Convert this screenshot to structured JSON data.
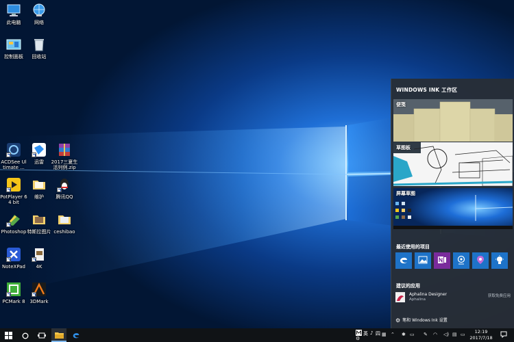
{
  "desktop": {
    "icons": [
      {
        "label": "此电脑",
        "icon": "computer-icon"
      },
      {
        "label": "网络",
        "icon": "network-icon"
      },
      {
        "label": "控制面板",
        "icon": "control-panel-icon"
      },
      {
        "label": "回收站",
        "icon": "recycle-bin-icon"
      },
      {
        "label": "ACDSee Ultimate ...",
        "icon": "acdsee-icon"
      },
      {
        "label": "迅雷",
        "icon": "xunlei-icon"
      },
      {
        "label": "2017三夏生活列例.zip",
        "icon": "winrar-archive-icon"
      },
      {
        "label": "PotPlayer 64 bit",
        "icon": "potplayer-icon"
      },
      {
        "label": "维护",
        "icon": "folder-icon"
      },
      {
        "label": "腾讯QQ",
        "icon": "qq-icon"
      },
      {
        "label": "Photoshop",
        "icon": "photoshop-icon"
      },
      {
        "label": "特斯拉图片",
        "icon": "image-folder-icon"
      },
      {
        "label": "ceshibao",
        "icon": "folder-icon"
      },
      {
        "label": "NoteXPad",
        "icon": "notexpad-icon"
      },
      {
        "label": "4K",
        "icon": "document-icon"
      },
      {
        "label": "PCMark 8",
        "icon": "pcmark-icon"
      },
      {
        "label": "3DMark",
        "icon": "3dmark-icon"
      }
    ]
  },
  "ink": {
    "title": "WINDOWS INK 工作区",
    "sticky_label": "便笺",
    "sketchpad_label": "草图板",
    "screen_sketch_label": "屏幕草图",
    "recent_title": "最近使用的项目",
    "recent_apps": [
      {
        "icon": "edge-icon",
        "color": "#1e73c8"
      },
      {
        "icon": "photos-icon",
        "color": "#1e73c8"
      },
      {
        "icon": "onenote-icon",
        "color": "#7a2b9c"
      },
      {
        "icon": "webcam-icon",
        "color": "#1e73c8"
      },
      {
        "icon": "maps-pin-icon",
        "color": "#1e73c8"
      },
      {
        "icon": "tips-bulb-icon",
        "color": "#1e73c8"
      }
    ],
    "suggest_title": "建议的应用",
    "suggest_name": "Aphalina Designer",
    "suggest_vendor": "Aphalina",
    "suggest_get": "获取免费应用",
    "settings_label": "笔和 Windows Ink 设置"
  },
  "taskbar": {
    "ime_mode": "英",
    "ime_extra": "♪",
    "ime_input": "四",
    "time": "12:19",
    "date": "2017/7/18",
    "accent": "#1e73c8"
  }
}
